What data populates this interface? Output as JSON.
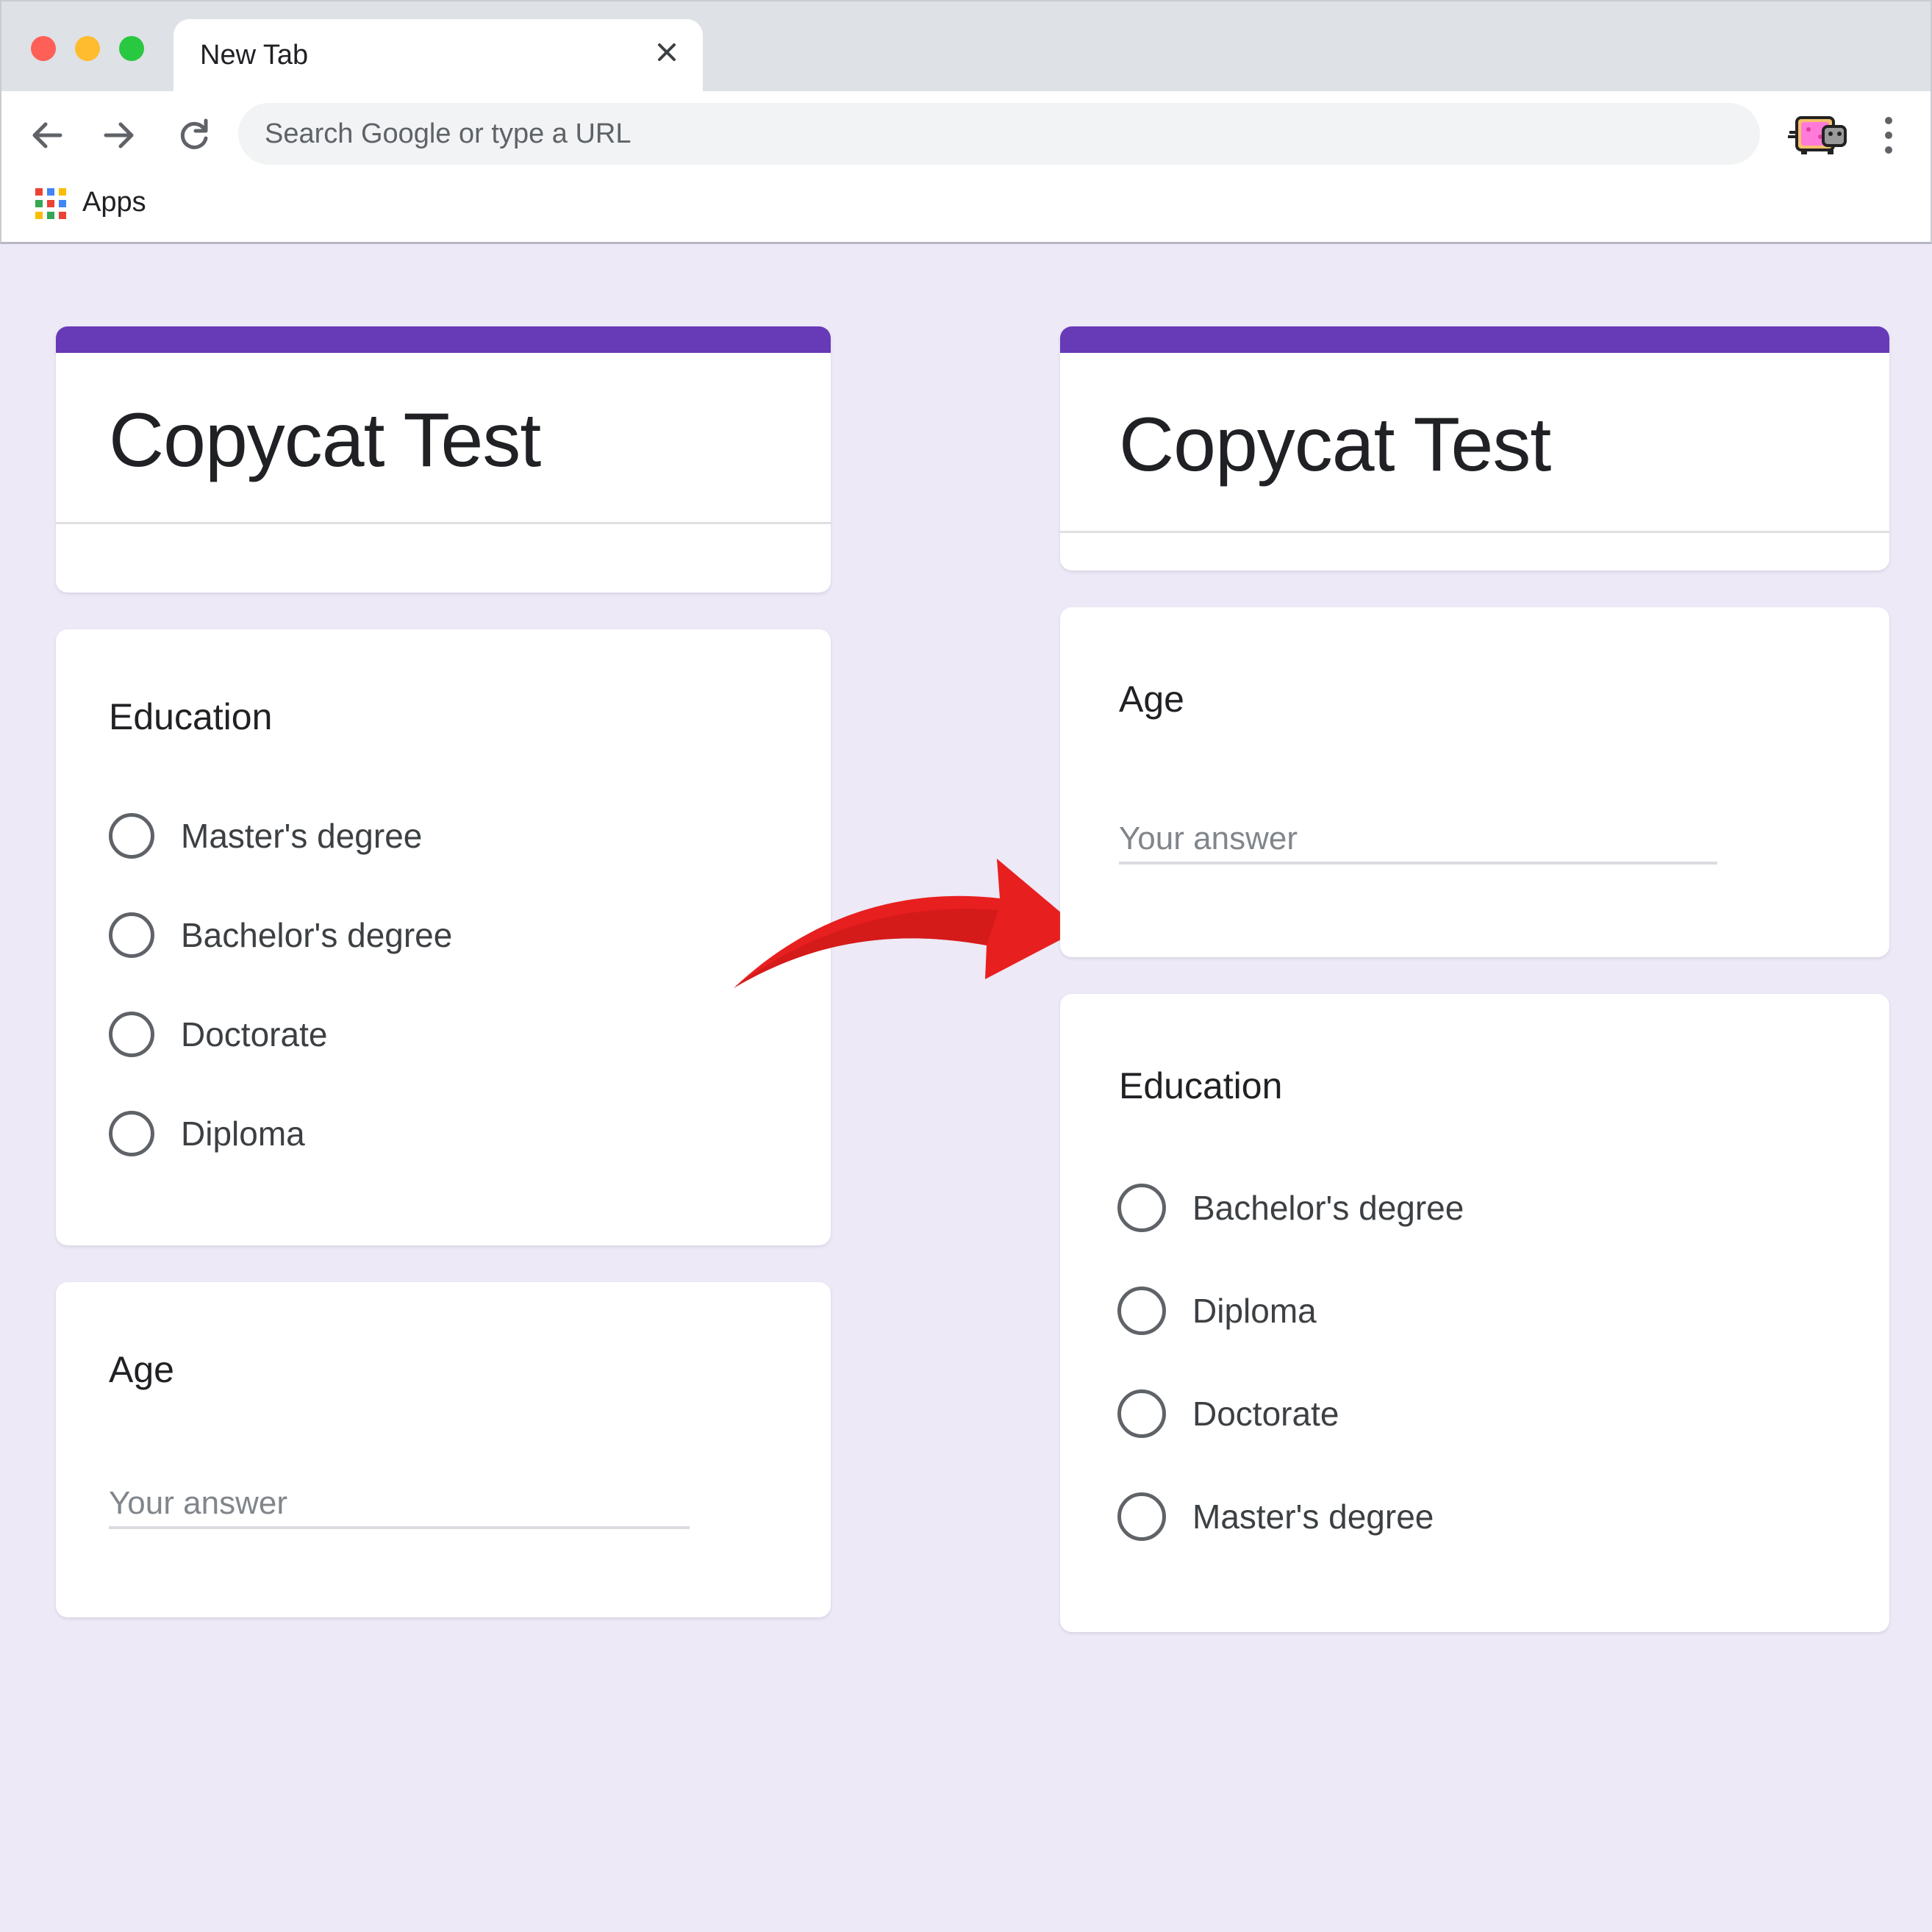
{
  "browser": {
    "tab_title": "New Tab",
    "omnibox_placeholder": "Search Google or type a URL",
    "bookmarks": [
      {
        "label": "Apps",
        "icon": "apps-grid-icon"
      }
    ],
    "icons": [
      "back-arrow-icon",
      "forward-arrow-icon",
      "reload-icon",
      "close-icon",
      "profile-avatar-icon",
      "more-vert-icon"
    ]
  },
  "colors": {
    "page_background": "#ede9f6",
    "form_accent": "#673ab7",
    "arrow": "#e81f1f"
  },
  "left_form": {
    "title": "Copycat Test",
    "questions": [
      {
        "label": "Education",
        "type": "radio",
        "options": [
          "Master's degree",
          "Bachelor's degree",
          "Doctorate",
          "Diploma"
        ]
      },
      {
        "label": "Age",
        "type": "text",
        "placeholder": "Your answer"
      }
    ]
  },
  "right_form": {
    "title": "Copycat Test",
    "questions": [
      {
        "label": "Age",
        "type": "text",
        "placeholder": "Your answer"
      },
      {
        "label": "Education",
        "type": "radio",
        "options": [
          "Bachelor's degree",
          "Diploma",
          "Doctorate",
          "Master's degree"
        ]
      }
    ]
  }
}
